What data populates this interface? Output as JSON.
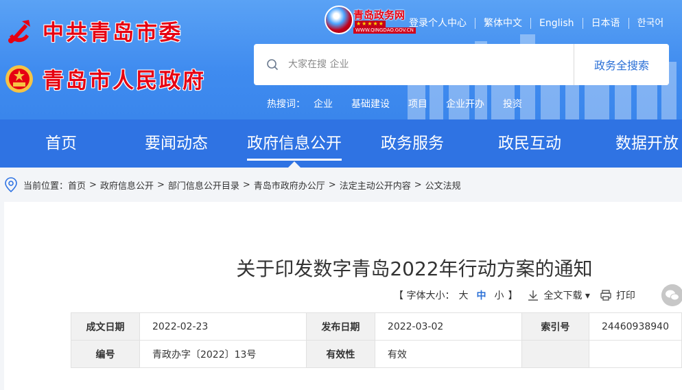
{
  "header": {
    "org_party": "中共青岛市委",
    "org_gov": "青岛市人民政府",
    "portal": {
      "name": "青岛政务网",
      "domain": "WWW.QINGDAO.GOV.CN",
      "stars": "★★★★★"
    },
    "top_links": [
      "登录个人中心",
      "繁体中文",
      "English",
      "日本语",
      "한국어"
    ],
    "search": {
      "placeholder": "大家在搜 企业",
      "button": "政务全搜索"
    },
    "hot": {
      "label": "热搜词：",
      "words": [
        "企业",
        "基础建设",
        "项目",
        "企业开办",
        "投资"
      ]
    }
  },
  "nav": {
    "items": [
      "首页",
      "要闻动态",
      "政府信息公开",
      "政务服务",
      "政民互动",
      "数据开放"
    ],
    "active_index": 2
  },
  "breadcrumb": {
    "label": "当前位置：",
    "items": [
      "首页",
      "政府信息公开",
      "部门信息公开目录",
      "青岛市政府办公厅",
      "法定主动公开内容",
      "公文法规"
    ],
    "separator": ">"
  },
  "article": {
    "title": "关于印发数字青岛2022年行动方案的通知",
    "font_size_label": "【 字体大小：",
    "font_big": "大",
    "font_mid": "中",
    "font_small": "小",
    "font_close": "】",
    "download": "全文下载",
    "print": "打印"
  },
  "meta": {
    "row1": {
      "k1": "成文日期",
      "v1": "2022-02-23",
      "k2": "发布日期",
      "v2": "2022-03-02",
      "k3": "索引号",
      "v3": "24460938940"
    },
    "row2": {
      "k1": "编号",
      "v1": "青政办字〔2022〕13号",
      "k2": "有效性",
      "v2": "有效",
      "k3": "",
      "v3": ""
    }
  },
  "colors": {
    "header_blue": "#4a93f1",
    "nav_blue": "#2f73e3",
    "org_red": "#e60012",
    "link_blue": "#2a6fd6"
  }
}
